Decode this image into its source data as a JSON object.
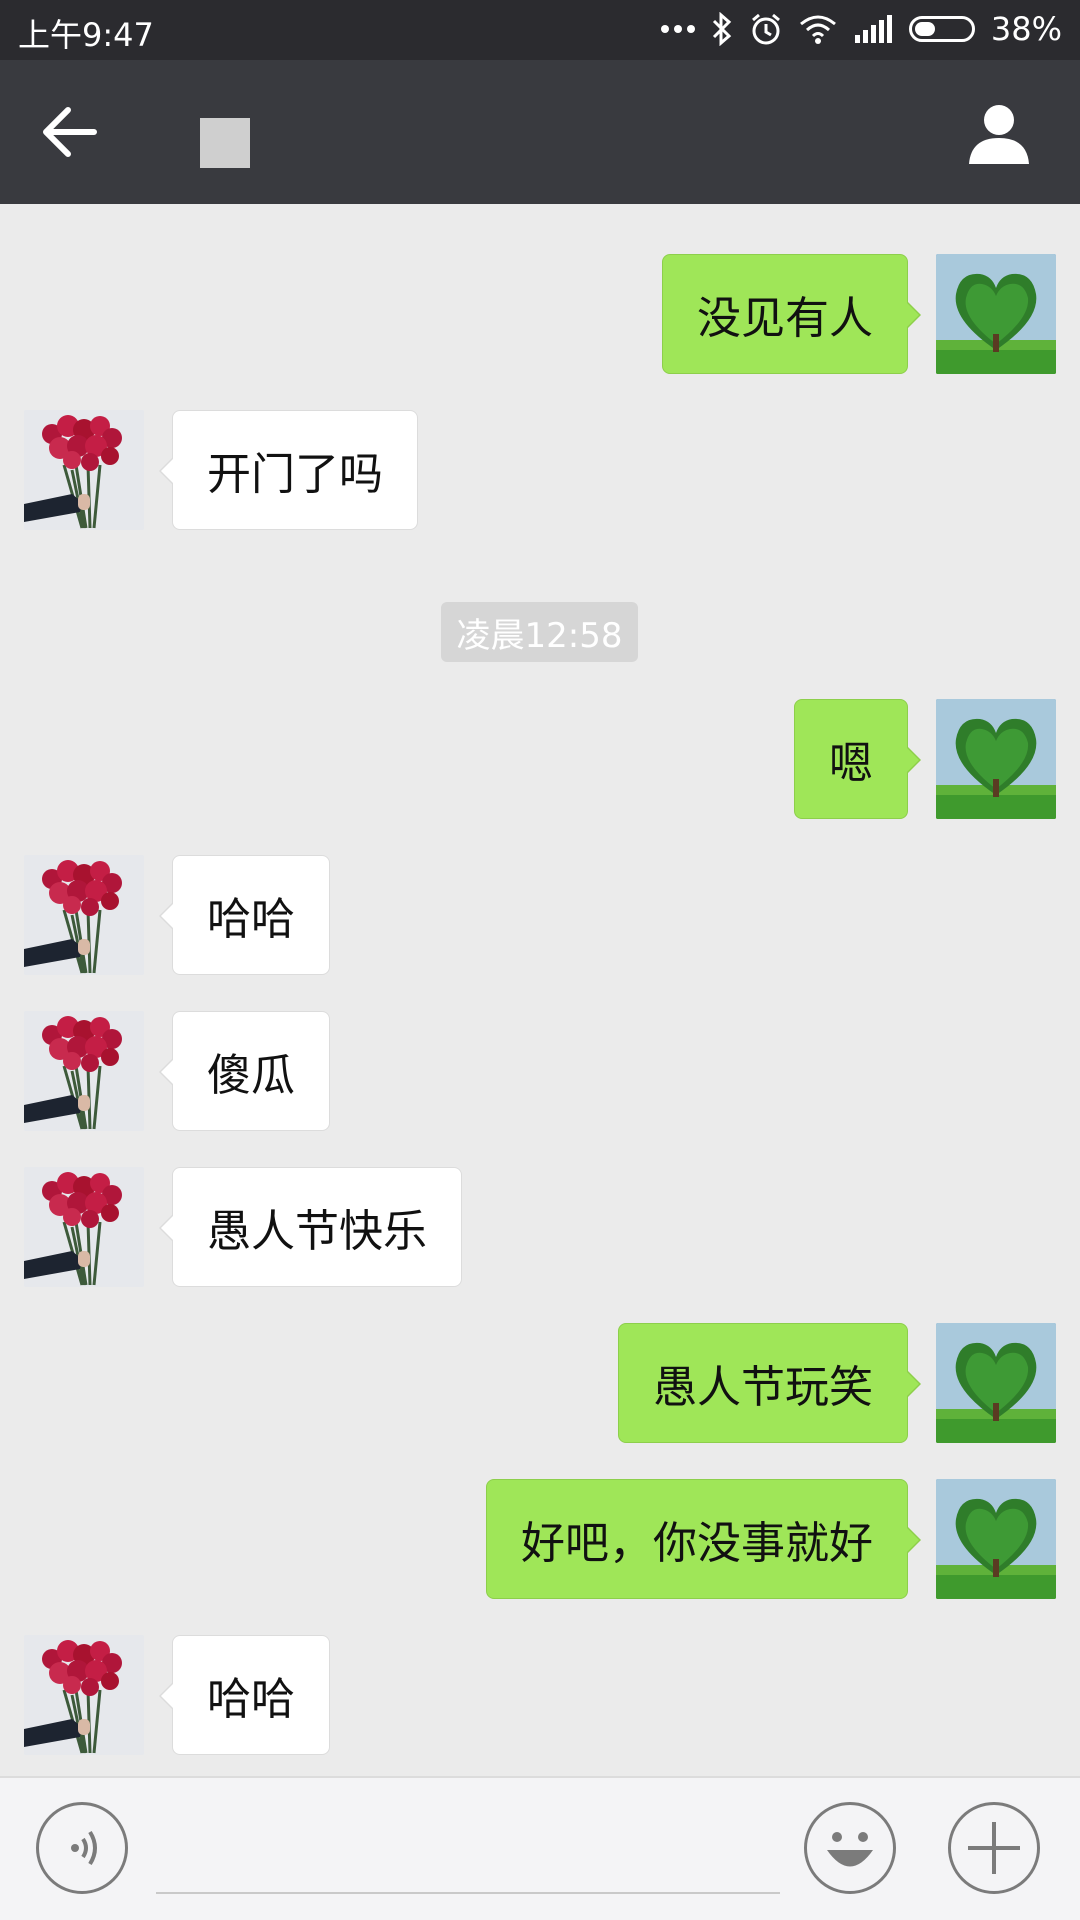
{
  "status_bar": {
    "time": "上午9:47",
    "battery_percent": "38%",
    "battery_level": 0.38
  },
  "nav": {
    "back_icon": "back-arrow-icon",
    "contact_icon": "person-icon"
  },
  "timestamp": "凌晨12:58",
  "messages": [
    {
      "side": "left",
      "text": ""
    },
    {
      "side": "right",
      "text": "没见有人"
    },
    {
      "side": "left",
      "text": "开门了吗"
    },
    {
      "side": "right",
      "text": "嗯"
    },
    {
      "side": "left",
      "text": "哈哈"
    },
    {
      "side": "left",
      "text": "傻瓜"
    },
    {
      "side": "left",
      "text": "愚人节快乐"
    },
    {
      "side": "right",
      "text": "愚人节玩笑"
    },
    {
      "side": "right",
      "text": "好吧，你没事就好"
    },
    {
      "side": "left",
      "text": "哈哈"
    }
  ],
  "input": {
    "placeholder": "",
    "voice_icon": "voice-icon",
    "emoji_icon": "emoji-icon",
    "plus_icon": "plus-icon"
  },
  "colors": {
    "nav_bg": "#393a3f",
    "sent_bubble": "#9fe658",
    "received_bubble": "#ffffff",
    "chat_bg": "#ebebeb"
  }
}
